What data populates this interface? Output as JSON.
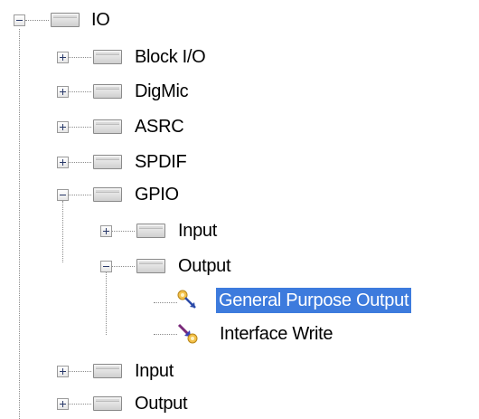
{
  "tree": {
    "root": {
      "label": "IO",
      "expanded": true
    },
    "block_io": {
      "label": "Block I/O",
      "expanded": false
    },
    "digmic": {
      "label": "DigMic",
      "expanded": false
    },
    "asrc": {
      "label": "ASRC",
      "expanded": false
    },
    "spdif": {
      "label": "SPDIF",
      "expanded": false
    },
    "gpio": {
      "label": "GPIO",
      "expanded": true,
      "input": {
        "label": "Input",
        "expanded": false
      },
      "output": {
        "label": "Output",
        "expanded": true,
        "items": [
          {
            "label": "General Purpose Output",
            "selected": true,
            "icon": "general-purpose-output-icon"
          },
          {
            "label": "Interface Write",
            "selected": false,
            "icon": "interface-write-icon"
          }
        ]
      }
    },
    "input": {
      "label": "Input",
      "expanded": false
    },
    "output": {
      "label": "Output",
      "expanded": false
    }
  },
  "colors": {
    "selection": "#3d7bdd",
    "selection_text": "#ffffff"
  }
}
